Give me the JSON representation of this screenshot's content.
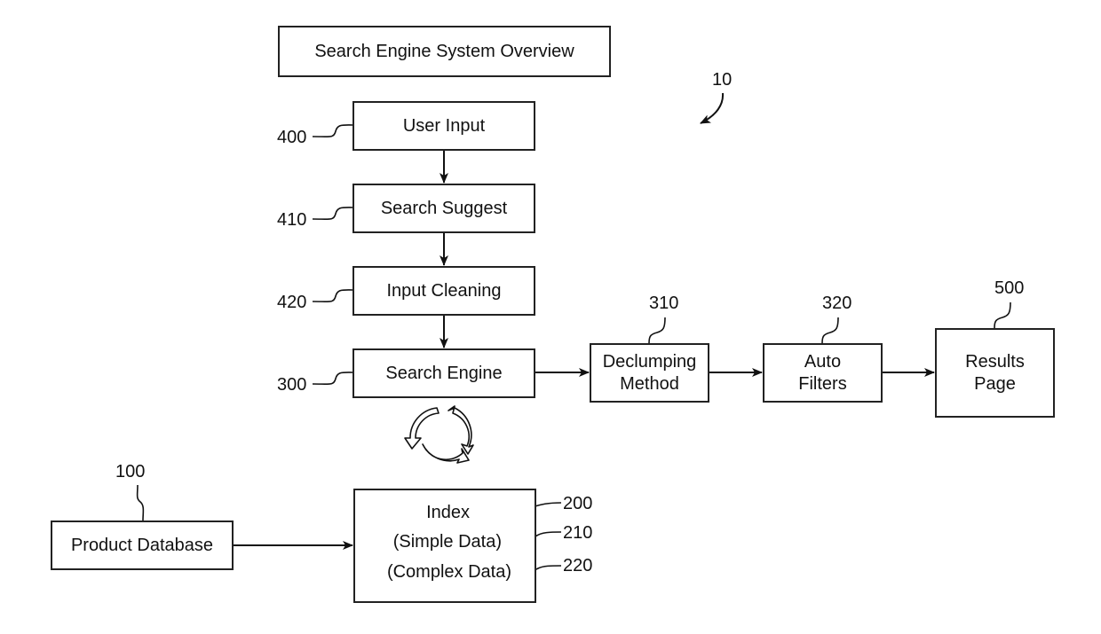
{
  "title": "Search Engine System Overview",
  "figure_ref": "10",
  "nodes": {
    "user_input": {
      "label": "User Input",
      "ref": "400"
    },
    "search_suggest": {
      "label": "Search Suggest",
      "ref": "410"
    },
    "input_cleaning": {
      "label": "Input Cleaning",
      "ref": "420"
    },
    "search_engine": {
      "label": "Search Engine",
      "ref": "300"
    },
    "declumping": {
      "label_line1": "Declumping",
      "label_line2": "Method",
      "ref": "310"
    },
    "auto_filters": {
      "label_line1": "Auto",
      "label_line2": "Filters",
      "ref": "320"
    },
    "results_page": {
      "label_line1": "Results",
      "label_line2": "Page",
      "ref": "500"
    },
    "product_database": {
      "label": "Product Database",
      "ref": "100"
    },
    "index": {
      "lines": [
        {
          "label": "Index",
          "ref": "200"
        },
        {
          "label": "(Simple Data)",
          "ref": "210"
        },
        {
          "label": "(Complex Data)",
          "ref": "220"
        }
      ]
    }
  },
  "edges": [
    {
      "from": "User Input",
      "to": "Search Suggest"
    },
    {
      "from": "Search Suggest",
      "to": "Input Cleaning"
    },
    {
      "from": "Input Cleaning",
      "to": "Search Engine"
    },
    {
      "from": "Search Engine",
      "to": "Declumping Method"
    },
    {
      "from": "Declumping Method",
      "to": "Auto Filters"
    },
    {
      "from": "Auto Filters",
      "to": "Results Page"
    },
    {
      "from": "Product Database",
      "to": "Index"
    }
  ],
  "icons": {
    "cycle": "recycle-arrows-icon"
  }
}
